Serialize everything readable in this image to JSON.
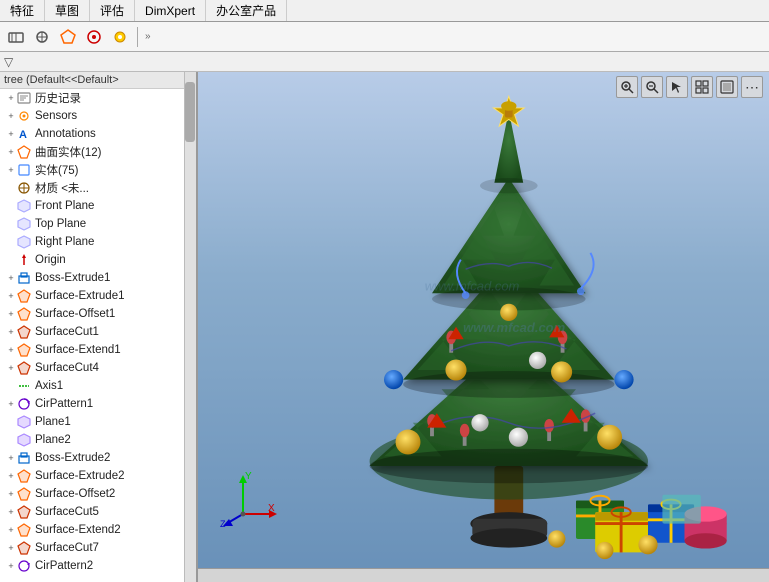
{
  "menu": {
    "tabs": [
      {
        "label": "特征",
        "active": false
      },
      {
        "label": "草图",
        "active": false
      },
      {
        "label": "评估",
        "active": false
      },
      {
        "label": "DimXpert",
        "active": false
      },
      {
        "label": "办公室产品",
        "active": false
      }
    ]
  },
  "toolbar": {
    "buttons": [
      "⊕",
      "◈",
      "⬡",
      "◉",
      "☀"
    ],
    "expand_label": "»"
  },
  "filter": {
    "icon": "▽"
  },
  "tree": {
    "header": "tree (Default<<Default>",
    "items": [
      {
        "indent": 0,
        "icon": "📋",
        "icon_class": "icon-history",
        "label": "历史记录",
        "has_expand": true,
        "expand_char": "+"
      },
      {
        "indent": 0,
        "icon": "◉",
        "icon_class": "icon-sensor",
        "label": "Sensors",
        "has_expand": true,
        "expand_char": "+"
      },
      {
        "indent": 0,
        "icon": "A",
        "icon_class": "icon-annotation",
        "label": "Annotations",
        "has_expand": true,
        "expand_char": "+"
      },
      {
        "indent": 0,
        "icon": "⬡",
        "icon_class": "icon-surface",
        "label": "曲面实体(12)",
        "has_expand": true,
        "expand_char": "+"
      },
      {
        "indent": 0,
        "icon": "□",
        "icon_class": "icon-solid",
        "label": "实体(75)",
        "has_expand": true,
        "expand_char": "+"
      },
      {
        "indent": 0,
        "icon": "◈",
        "icon_class": "icon-material",
        "label": "材质 <未...",
        "has_expand": false,
        "expand_char": ""
      },
      {
        "indent": 0,
        "icon": "◇",
        "icon_class": "icon-plane",
        "label": "Front Plane",
        "has_expand": false,
        "expand_char": ""
      },
      {
        "indent": 0,
        "icon": "◇",
        "icon_class": "icon-plane",
        "label": "Top Plane",
        "has_expand": false,
        "expand_char": ""
      },
      {
        "indent": 0,
        "icon": "◇",
        "icon_class": "icon-plane",
        "label": "Right Plane",
        "has_expand": false,
        "expand_char": ""
      },
      {
        "indent": 0,
        "icon": "↑",
        "icon_class": "icon-origin",
        "label": "Origin",
        "has_expand": false,
        "expand_char": ""
      },
      {
        "indent": 0,
        "icon": "▭",
        "icon_class": "icon-boss",
        "label": "Boss-Extrude1",
        "has_expand": true,
        "expand_char": "+"
      },
      {
        "indent": 0,
        "icon": "⬡",
        "icon_class": "icon-surface-feat",
        "label": "Surface-Extrude1",
        "has_expand": true,
        "expand_char": "+"
      },
      {
        "indent": 0,
        "icon": "⬡",
        "icon_class": "icon-surface-feat",
        "label": "Surface-Offset1",
        "has_expand": true,
        "expand_char": "+"
      },
      {
        "indent": 0,
        "icon": "⬡",
        "icon_class": "icon-cut",
        "label": "SurfaceCut1",
        "has_expand": true,
        "expand_char": "+"
      },
      {
        "indent": 0,
        "icon": "⬡",
        "icon_class": "icon-surface-feat",
        "label": "Surface-Extend1",
        "has_expand": true,
        "expand_char": "+"
      },
      {
        "indent": 0,
        "icon": "⬡",
        "icon_class": "icon-cut",
        "label": "SurfaceCut4",
        "has_expand": true,
        "expand_char": "+"
      },
      {
        "indent": 0,
        "icon": "—",
        "icon_class": "icon-axis",
        "label": "Axis1",
        "has_expand": false,
        "expand_char": ""
      },
      {
        "indent": 0,
        "icon": "⟳",
        "icon_class": "icon-pattern",
        "label": "CirPattern1",
        "has_expand": true,
        "expand_char": "+"
      },
      {
        "indent": 0,
        "icon": "◇",
        "icon_class": "icon-plane-custom",
        "label": "Plane1",
        "has_expand": false,
        "expand_char": ""
      },
      {
        "indent": 0,
        "icon": "◇",
        "icon_class": "icon-plane-custom",
        "label": "Plane2",
        "has_expand": false,
        "expand_char": ""
      },
      {
        "indent": 0,
        "icon": "▭",
        "icon_class": "icon-boss",
        "label": "Boss-Extrude2",
        "has_expand": true,
        "expand_char": "+"
      },
      {
        "indent": 0,
        "icon": "⬡",
        "icon_class": "icon-surface-feat",
        "label": "Surface-Extrude2",
        "has_expand": true,
        "expand_char": "+"
      },
      {
        "indent": 0,
        "icon": "⬡",
        "icon_class": "icon-surface-feat",
        "label": "Surface-Offset2",
        "has_expand": true,
        "expand_char": "+"
      },
      {
        "indent": 0,
        "icon": "⬡",
        "icon_class": "icon-cut",
        "label": "SurfaceCut5",
        "has_expand": true,
        "expand_char": "+"
      },
      {
        "indent": 0,
        "icon": "⬡",
        "icon_class": "icon-surface-feat",
        "label": "Surface-Extend2",
        "has_expand": true,
        "expand_char": "+"
      },
      {
        "indent": 0,
        "icon": "⬡",
        "icon_class": "icon-cut",
        "label": "SurfaceCut7",
        "has_expand": true,
        "expand_char": "+"
      },
      {
        "indent": 0,
        "icon": "⟳",
        "icon_class": "icon-pattern",
        "label": "CirPattern2",
        "has_expand": true,
        "expand_char": "+"
      }
    ]
  },
  "viewport": {
    "watermark": "www.mfcad.com",
    "watermark2": "www.mfcad.com"
  },
  "viewport_toolbar": {
    "buttons": [
      "🔍",
      "🔍",
      "↗",
      "⊞",
      "▣",
      "⋯"
    ]
  }
}
